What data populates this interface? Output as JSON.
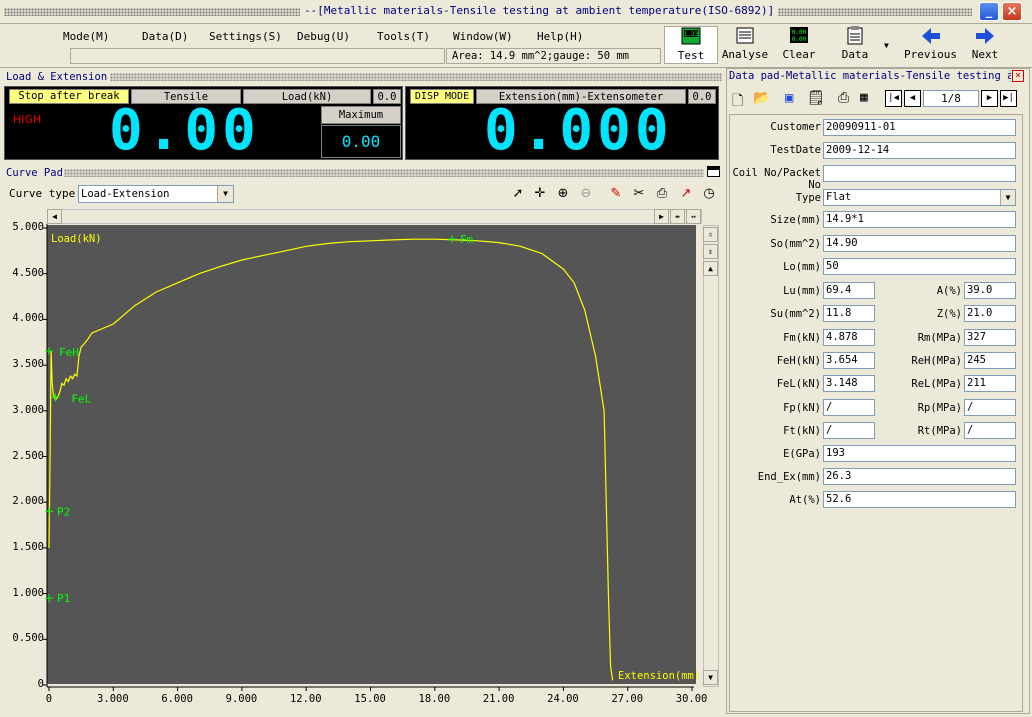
{
  "window": {
    "title": "--[Metallic materials-Tensile testing at ambient temperature(ISO-6892)]"
  },
  "menu": [
    {
      "label": "Mode(M)"
    },
    {
      "label": "Data(D)"
    },
    {
      "label": "Settings(S)"
    },
    {
      "label": "Debug(U)"
    },
    {
      "label": "Tools(T)"
    },
    {
      "label": "Window(W)"
    },
    {
      "label": "Help(H)"
    }
  ],
  "status": {
    "area_info": "Area: 14.9 mm^2;gauge: 50 mm"
  },
  "toolbar": {
    "test": "Test",
    "analyse": "Analyse",
    "clear": "Clear",
    "data": "Data",
    "previous": "Previous",
    "next": "Next"
  },
  "load_panel": {
    "title": "Load & Extension",
    "stop_label": "Stop after break",
    "tensile_label": "Tensile",
    "load_label": "Load(kN)",
    "load_value": "0.0",
    "high_label": "HIGH",
    "big_value": "0.00",
    "maximum_label": "Maximum",
    "max_value": "0.00",
    "disp_mode_label": "DISP MODE",
    "ext_label": "Extension(mm)-Extensometer",
    "ext_small_value": "0.0",
    "ext_big_value": "0.000"
  },
  "curve": {
    "title": "Curve Pad",
    "type_label": "Curve type:",
    "type_value": "Load-Extension",
    "y_axis_label": "Load(kN)",
    "x_axis_label": "Extension(mm)",
    "markers": {
      "feh": "FeH",
      "fel": "FeL",
      "p2": "P2",
      "p1": "P1",
      "fm": "Fm"
    }
  },
  "chart_data": {
    "type": "line",
    "xlabel": "Extension(mm)",
    "ylabel": "Load(kN)",
    "xlim": [
      0,
      30
    ],
    "ylim": [
      0,
      5
    ],
    "xticks": [
      "0",
      "3.000",
      "6.000",
      "9.000",
      "12.00",
      "15.00",
      "18.00",
      "21.00",
      "24.00",
      "27.00",
      "30.00"
    ],
    "yticks": [
      "0",
      "0.500",
      "1.000",
      "1.500",
      "2.000",
      "2.500",
      "3.000",
      "3.500",
      "4.000",
      "4.500",
      "5.000"
    ],
    "series": [
      {
        "x": [
          0,
          0.05,
          0.1,
          0.15,
          0.2,
          0.3,
          0.4,
          0.5,
          0.6,
          0.7,
          0.8,
          0.9,
          1.0,
          1.1,
          1.2,
          1.3,
          1.4,
          1.5,
          1.6,
          1.7,
          1.8,
          2.0,
          2.5,
          3.0,
          3.5,
          4.0,
          5.0,
          6.0,
          7.0,
          8.0,
          9.0,
          10,
          11,
          12,
          13,
          14,
          15,
          16,
          17,
          18,
          19,
          20,
          21,
          22,
          23,
          24,
          24.5,
          25,
          25.5,
          25.9,
          26.1,
          26.2,
          26.3
        ],
        "y": [
          1.5,
          2.5,
          3.654,
          3.3,
          3.18,
          3.12,
          3.15,
          3.2,
          3.3,
          3.28,
          3.35,
          3.32,
          3.38,
          3.35,
          3.4,
          3.38,
          3.6,
          3.7,
          3.72,
          3.75,
          3.78,
          3.85,
          3.9,
          3.95,
          4.05,
          4.15,
          4.3,
          4.4,
          4.5,
          4.58,
          4.65,
          4.7,
          4.75,
          4.8,
          4.83,
          4.85,
          4.86,
          4.87,
          4.878,
          4.878,
          4.87,
          4.86,
          4.84,
          4.8,
          4.72,
          4.55,
          4.4,
          4.1,
          3.6,
          3.0,
          1.0,
          0.2,
          0.05
        ]
      }
    ],
    "annotations": [
      {
        "label": "FeH",
        "x": 0,
        "y": 3.654
      },
      {
        "label": "FeL",
        "x": 0.3,
        "y": 3.148
      },
      {
        "label": "P2",
        "x": 0,
        "y": 1.9
      },
      {
        "label": "P1",
        "x": 0,
        "y": 0.95
      },
      {
        "label": "Fm",
        "x": 18.8,
        "y": 4.878
      }
    ],
    "colors": {
      "curve": "#ffff00",
      "markers": "#00ff00",
      "background": "#555555"
    }
  },
  "datapad": {
    "title": "Data pad-Metallic materials-Tensile testing at",
    "page": "1/8",
    "fields": [
      {
        "label": "Customer",
        "value": "20090911-01"
      },
      {
        "label": "TestDate",
        "value": "2009-12-14"
      },
      {
        "label": "Coil No/Packet No",
        "value": ""
      },
      {
        "label": "Type",
        "value": "Flat"
      },
      {
        "label": "Size(mm)",
        "value": "14.9*1"
      },
      {
        "label": "So(mm^2)",
        "value": "14.90"
      },
      {
        "label": "Lo(mm)",
        "value": "50"
      }
    ],
    "pairs": [
      {
        "l1": "Lu(mm)",
        "v1": "69.4",
        "l2": "A(%)",
        "v2": "39.0"
      },
      {
        "l1": "Su(mm^2)",
        "v1": "11.8",
        "l2": "Z(%)",
        "v2": "21.0"
      },
      {
        "l1": "Fm(kN)",
        "v1": "4.878",
        "l2": "Rm(MPa)",
        "v2": "327"
      },
      {
        "l1": "FeH(kN)",
        "v1": "3.654",
        "l2": "ReH(MPa)",
        "v2": "245"
      },
      {
        "l1": "FeL(kN)",
        "v1": "3.148",
        "l2": "ReL(MPa)",
        "v2": "211"
      },
      {
        "l1": "Fp(kN)",
        "v1": "/",
        "l2": "Rp(MPa)",
        "v2": "/"
      },
      {
        "l1": "Ft(kN)",
        "v1": "/",
        "l2": "Rt(MPa)",
        "v2": "/"
      }
    ],
    "bottom": [
      {
        "label": "E(GPa)",
        "value": "193"
      },
      {
        "label": "End_Ex(mm)",
        "value": "26.3"
      },
      {
        "label": "At(%)",
        "value": "52.6"
      }
    ]
  }
}
